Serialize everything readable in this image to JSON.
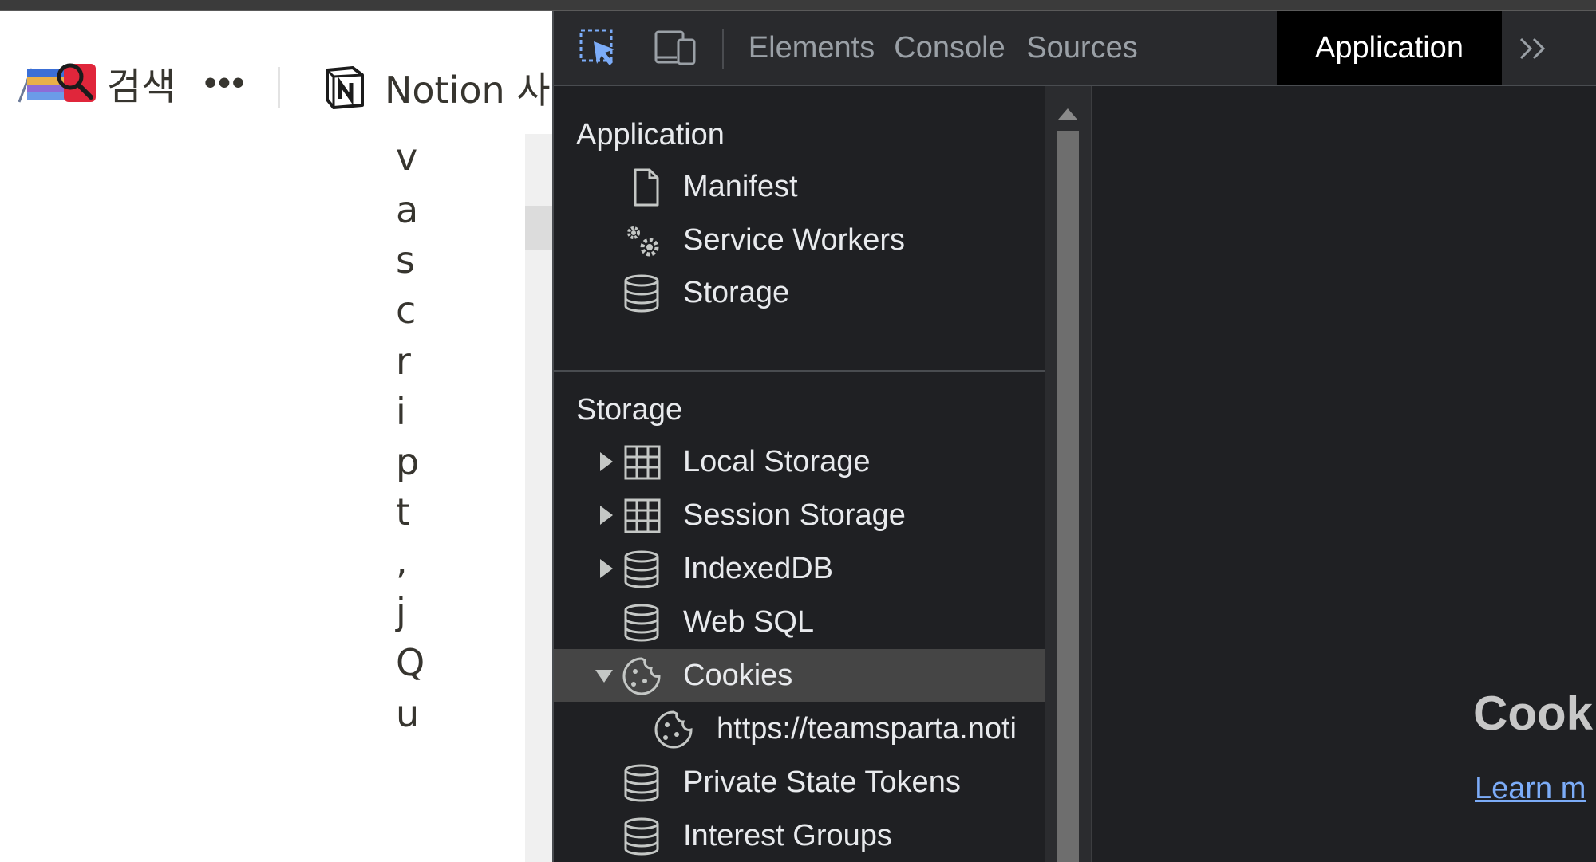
{
  "page": {
    "search_label": "검색",
    "more_label": "•••",
    "notion_title": "Notion 사",
    "vertical_chars": [
      "v",
      "a",
      "s",
      "c",
      "r",
      "i",
      "p",
      "t",
      ",",
      "j",
      "Q",
      "u"
    ]
  },
  "devtools": {
    "tabs": [
      {
        "label": "Elements",
        "active": false
      },
      {
        "label": "Console",
        "active": false
      },
      {
        "label": "Sources",
        "active": false
      },
      {
        "label": "Application",
        "active": true
      }
    ],
    "application_section": {
      "title": "Application",
      "items": [
        {
          "label": "Manifest",
          "icon": "document-icon"
        },
        {
          "label": "Service Workers",
          "icon": "gears-icon"
        },
        {
          "label": "Storage",
          "icon": "database-icon"
        }
      ]
    },
    "storage_section": {
      "title": "Storage",
      "items": [
        {
          "label": "Local Storage",
          "icon": "table-icon",
          "expandable": true
        },
        {
          "label": "Session Storage",
          "icon": "table-icon",
          "expandable": true
        },
        {
          "label": "IndexedDB",
          "icon": "database-icon",
          "expandable": true
        },
        {
          "label": "Web SQL",
          "icon": "database-icon",
          "expandable": false
        },
        {
          "label": "Cookies",
          "icon": "cookie-icon",
          "expandable": true,
          "expanded": true,
          "selected": true
        },
        {
          "label": "https://teamsparta.noti",
          "icon": "cookie-icon",
          "child": true
        },
        {
          "label": "Private State Tokens",
          "icon": "database-icon",
          "expandable": false
        },
        {
          "label": "Interest Groups",
          "icon": "database-icon",
          "expandable": false
        }
      ]
    },
    "main": {
      "heading": "Cook",
      "link": "Learn m"
    },
    "colors": {
      "background": "#1f2023",
      "active_tab": "#000000",
      "selected_row": "#454545",
      "link": "#7cacf8",
      "inspect_icon": "#7cacf8"
    }
  }
}
